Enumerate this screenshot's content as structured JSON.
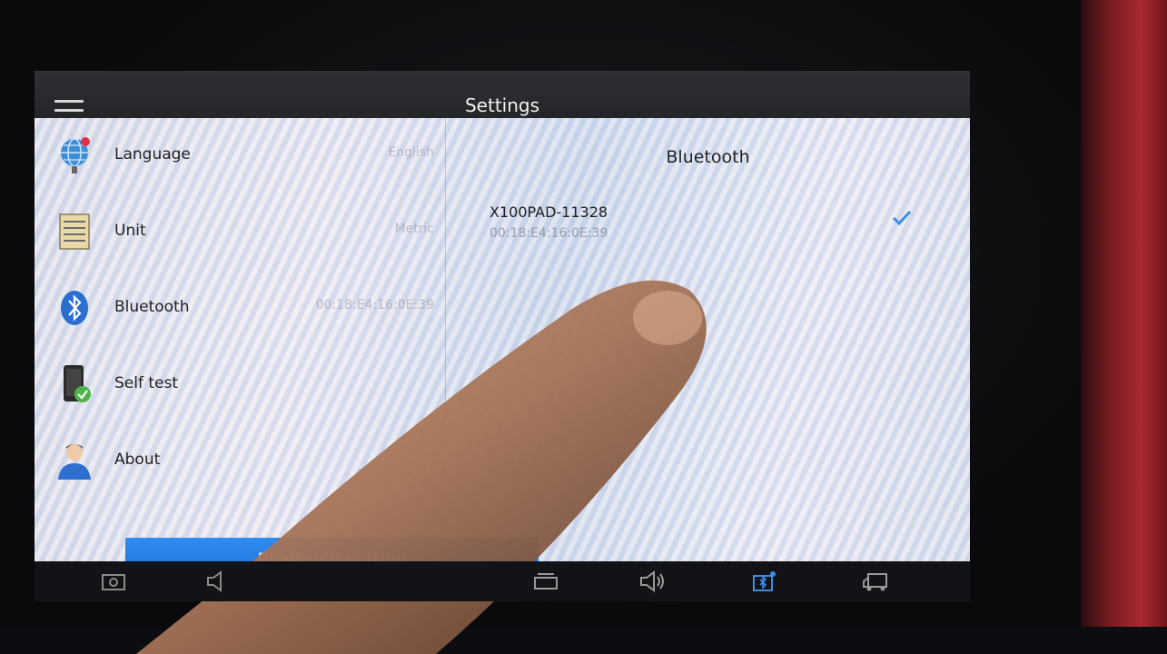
{
  "header": {
    "title": "Settings",
    "menu_icon": "hamburger-menu-icon"
  },
  "sidebar": {
    "items": [
      {
        "label": "Language",
        "value": "English",
        "icon": "globe-language-icon"
      },
      {
        "label": "Unit",
        "value": "Metric",
        "icon": "unit-table-icon"
      },
      {
        "label": "Bluetooth",
        "value": "00:18:E4:16:0E:39",
        "icon": "bluetooth-icon"
      },
      {
        "label": "Self test",
        "value": "",
        "icon": "phone-check-icon"
      },
      {
        "label": "About",
        "value": "",
        "icon": "person-avatar-icon"
      }
    ]
  },
  "bluetooth_panel": {
    "title": "Bluetooth",
    "device": {
      "name": "X100PAD-11328",
      "mac": "00:18:E4:16:0E:39",
      "selected": true
    },
    "setting_button": "Bluetooth setting"
  },
  "navbar": {
    "icons": [
      "screenshot-icon",
      "volume-down-icon",
      "recent-apps-icon",
      "volume-up-icon",
      "vci-connect-icon",
      "truck-icon"
    ]
  },
  "colors": {
    "accent": "#1f78e0",
    "check": "#3a8ee6"
  }
}
